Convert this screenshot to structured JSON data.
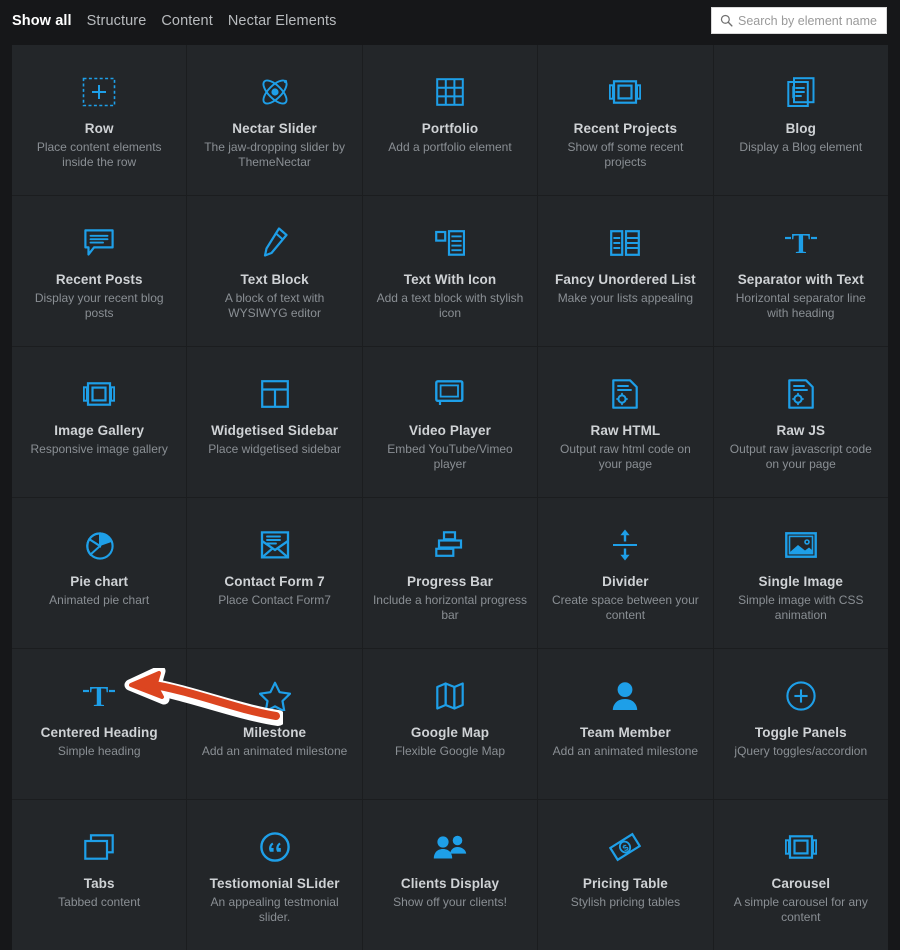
{
  "header": {
    "tabs": [
      {
        "label": "Show all",
        "active": true
      },
      {
        "label": "Structure",
        "active": false
      },
      {
        "label": "Content",
        "active": false
      },
      {
        "label": "Nectar Elements",
        "active": false
      }
    ],
    "search": {
      "placeholder": "Search by element name",
      "value": "",
      "icon": "search-icon"
    }
  },
  "colors": {
    "background": "#161719",
    "card": "#232629",
    "accent_blue": "#1E9FE8",
    "title_text": "#cfd2d5",
    "desc_text": "#8a8f94",
    "annotation_orange": "#dc4520",
    "annotation_outline": "#ffffff"
  },
  "annotation": {
    "type": "curved-arrow",
    "points_to": "Centered Heading",
    "color": "#dc4520"
  },
  "grid": {
    "columns": 5,
    "elements": [
      {
        "title": "Row",
        "desc": "Place content elements inside the row",
        "icon": "dashed-box-plus-icon"
      },
      {
        "title": "Nectar Slider",
        "desc": "The jaw-dropping slider by ThemeNectar",
        "icon": "atom-icon"
      },
      {
        "title": "Portfolio",
        "desc": "Add a portfolio element",
        "icon": "grid-table-icon"
      },
      {
        "title": "Recent Projects",
        "desc": "Show off some recent projects",
        "icon": "slide-frame-icon"
      },
      {
        "title": "Blog",
        "desc": "Display a Blog element",
        "icon": "documents-icon"
      },
      {
        "title": "Recent Posts",
        "desc": "Display your recent blog posts",
        "icon": "speech-bubble-icon"
      },
      {
        "title": "Text Block",
        "desc": "A block of text with WYSIWYG editor",
        "icon": "pencil-icon"
      },
      {
        "title": "Text With Icon",
        "desc": "Add a text block with stylish icon",
        "icon": "icon-with-lines-icon"
      },
      {
        "title": "Fancy Unordered List",
        "desc": "Make your lists appealing",
        "icon": "list-columns-icon"
      },
      {
        "title": "Separator with Text",
        "desc": "Horizontal separator line with heading",
        "icon": "t-separator-icon"
      },
      {
        "title": "Image Gallery",
        "desc": "Responsive image gallery",
        "icon": "slide-frame-icon"
      },
      {
        "title": "Widgetised Sidebar",
        "desc": "Place widgetised sidebar",
        "icon": "layout-sidebar-icon"
      },
      {
        "title": "Video Player",
        "desc": "Embed YouTube/Vimeo player",
        "icon": "video-monitor-icon"
      },
      {
        "title": "Raw HTML",
        "desc": "Output raw html code on your page",
        "icon": "code-document-icon"
      },
      {
        "title": "Raw JS",
        "desc": "Output raw javascript code on your page",
        "icon": "code-document-icon"
      },
      {
        "title": "Pie chart",
        "desc": "Animated pie chart",
        "icon": "pie-chart-icon"
      },
      {
        "title": "Contact Form 7",
        "desc": "Place Contact Form7",
        "icon": "envelope-icon"
      },
      {
        "title": "Progress Bar",
        "desc": "Include a horizontal progress bar",
        "icon": "bar-steps-icon"
      },
      {
        "title": "Divider",
        "desc": "Create space between your content",
        "icon": "up-down-arrows-icon"
      },
      {
        "title": "Single Image",
        "desc": "Simple image with CSS animation",
        "icon": "picture-frame-icon"
      },
      {
        "title": "Centered Heading",
        "desc": "Simple heading",
        "icon": "t-separator-icon"
      },
      {
        "title": "Milestone",
        "desc": "Add an animated milestone",
        "icon": "star-icon"
      },
      {
        "title": "Google Map",
        "desc": "Flexible Google Map",
        "icon": "folded-map-icon"
      },
      {
        "title": "Team Member",
        "desc": "Add an animated milestone",
        "icon": "person-icon"
      },
      {
        "title": "Toggle Panels",
        "desc": "jQuery toggles/accordion",
        "icon": "circle-plus-icon"
      },
      {
        "title": "Tabs",
        "desc": "Tabbed content",
        "icon": "stacked-windows-icon"
      },
      {
        "title": "Testiomonial SLider",
        "desc": "An appealing testmonial slider.",
        "icon": "quote-circle-icon"
      },
      {
        "title": "Clients Display",
        "desc": "Show off your clients!",
        "icon": "people-group-icon"
      },
      {
        "title": "Pricing Table",
        "desc": "Stylish pricing tables",
        "icon": "money-tag-icon"
      },
      {
        "title": "Carousel",
        "desc": "A simple carousel for any content",
        "icon": "slide-frame-icon"
      }
    ]
  }
}
